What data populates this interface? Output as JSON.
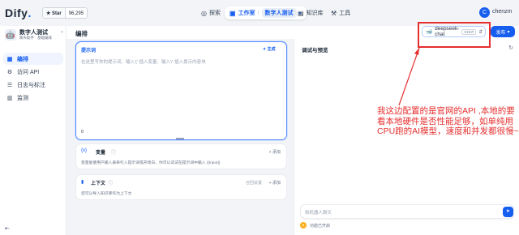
{
  "topbar": {
    "logo_text": "Dify",
    "logo_dot": ".",
    "github": {
      "star_label": "Star",
      "count": "96,295"
    },
    "nav": {
      "explore": "探索",
      "studio": "工作室",
      "app_chip": "数字人测试",
      "knowledge": "知识库",
      "tools": "工具"
    },
    "user": {
      "avatar_letter": "C",
      "name": "chenzm"
    }
  },
  "sidebar": {
    "app_name": "数字人测试",
    "app_sub": "聊天助手 · 基础编排",
    "items": [
      {
        "icon": "orchestrate-icon",
        "label": "编排",
        "active": true
      },
      {
        "icon": "api-icon",
        "label": "访问 API",
        "active": false
      },
      {
        "icon": "logs-icon",
        "label": "日志与标注",
        "active": false
      },
      {
        "icon": "monitor-icon",
        "label": "监测",
        "active": false
      }
    ]
  },
  "main": {
    "title": "编排",
    "model": {
      "name": "deepseek-chat",
      "tag": "CHAT"
    },
    "publish_label": "发布",
    "prompt": {
      "title": "提示词",
      "generate_label": "生成",
      "placeholder": "在这里写你的提示词，输入'{' 插入变量、输入'/' 插入提示内容块",
      "char_count": "0"
    },
    "variables": {
      "title": "变量",
      "add_label": "添加",
      "description": "变量能使用户输入表单引入提示词或开场白，你可以试试在提示词中输入 {{input}}"
    },
    "context": {
      "title": "上下文",
      "extra_label": "召回设置",
      "add_label": "添加",
      "description": "您可以导入知识库作为上下文"
    }
  },
  "preview": {
    "title": "调试与预览",
    "input_placeholder": "和机器人聊天",
    "footer_label": "功能已开启"
  },
  "annotation": {
    "text": "我这边配置的是官网的API ,本地的要看本地硬件是否性能足够，如单纯用CPU跑的AI模型，速度和并发都很慢~",
    "color": "#e62e2e"
  },
  "colors": {
    "accent": "#155eef",
    "annotation": "#e62e2e"
  }
}
